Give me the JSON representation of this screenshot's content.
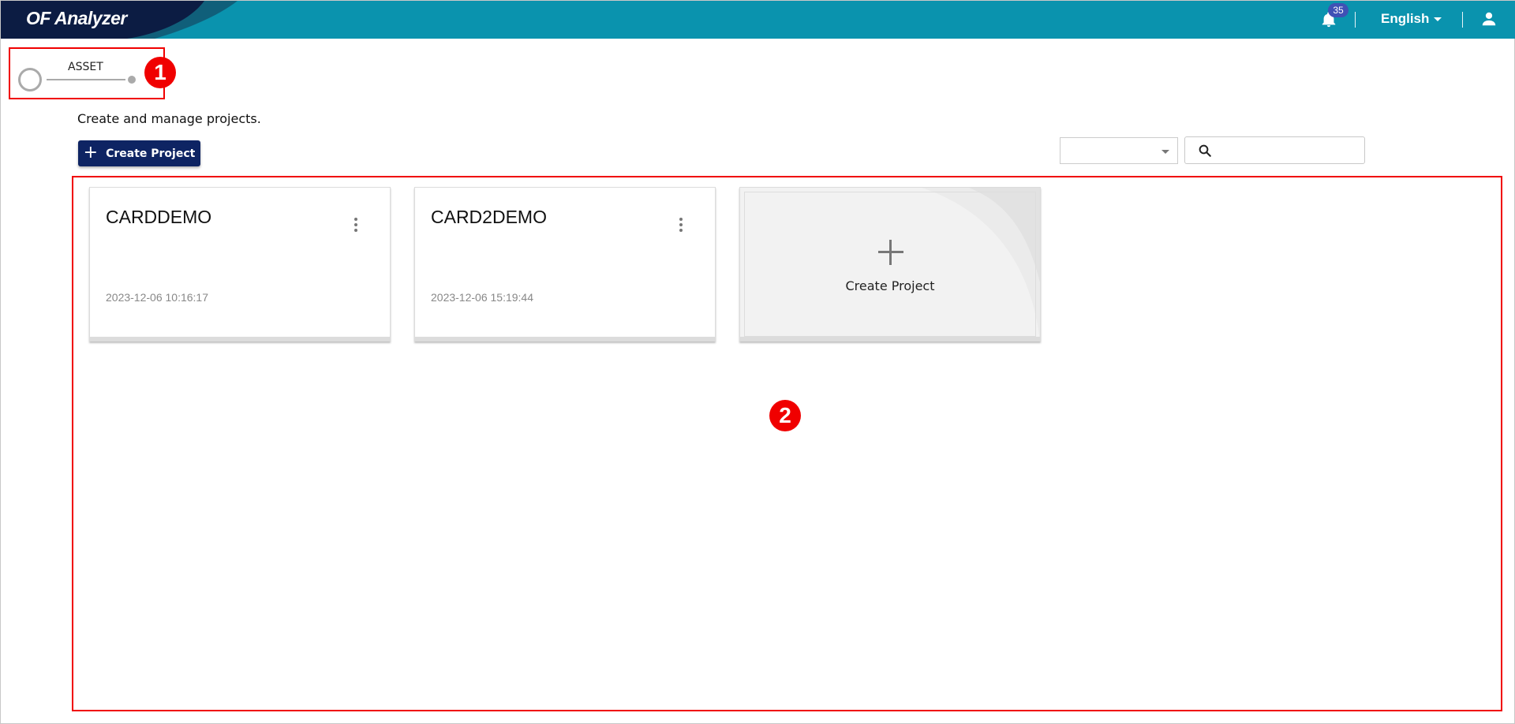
{
  "header": {
    "app_title": "OF Analyzer",
    "notification_count": "35",
    "language": "English",
    "icons": {
      "notifications": "bell-icon",
      "language_menu": "chevron-down-icon",
      "account": "user-icon"
    },
    "colors": {
      "header_bg": "#0a93ae",
      "logo_bg": "#0c1c43",
      "badge_bg": "#3f51b5"
    }
  },
  "stepper": {
    "steps": [
      {
        "label": "ASSET"
      }
    ]
  },
  "annotations": {
    "marker_1": "1",
    "marker_2": "2",
    "color": "#f00000"
  },
  "main": {
    "description": "Create and manage projects.",
    "create_button_label": "Create Project",
    "filter_select_value": "",
    "search_placeholder": "",
    "search_value": "",
    "accent_color": "#0e2463"
  },
  "projects": [
    {
      "name": "CARDDEMO",
      "date": "2023-12-06 10:16:17"
    },
    {
      "name": "CARD2DEMO",
      "date": "2023-12-06 15:19:44"
    }
  ],
  "new_project_card": {
    "label": "Create Project"
  }
}
